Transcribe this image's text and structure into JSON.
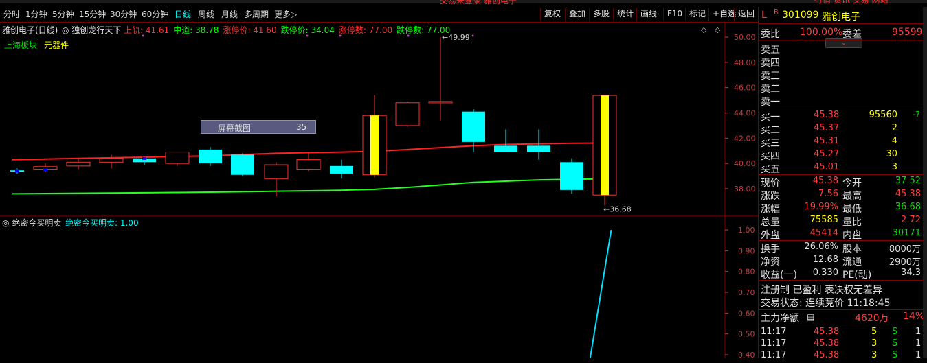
{
  "top_warning": "交易未登录  雅创电子",
  "toolbar": {
    "timeframes": [
      "分时",
      "1分钟",
      "5分钟",
      "15分钟",
      "30分钟",
      "60分钟",
      "日线",
      "周线",
      "月线",
      "多周期",
      "更多▷"
    ],
    "active_timeframe": "日线",
    "buttons": [
      "复权",
      "叠加",
      "多股",
      "统计",
      "画线",
      "F10",
      "标记",
      "+自选",
      "返回"
    ]
  },
  "right_top_buttons": "行情  资讯  交易  网站",
  "chart": {
    "stock_label": "雅创电子(日线)",
    "indicator_name": "独创龙行天下",
    "params": [
      {
        "label": "上轨: 41.61",
        "color": "#ff3030"
      },
      {
        "label": "中道: 38.78",
        "color": "#00ff00"
      },
      {
        "label": "涨停价: 41.60",
        "color": "#ff3030"
      },
      {
        "label": "跌停价: 34.04",
        "color": "#00ff00"
      },
      {
        "label": "涨停数: 77.00",
        "color": "#ff3030"
      },
      {
        "label": "跌停数: 77.00",
        "color": "#00ff00"
      }
    ],
    "sector": "上海板块",
    "industry": "元器件",
    "high_label": "49.99",
    "low_label": "36.68",
    "screenshot_tooltip": {
      "text": "屏幕截图",
      "value": "35"
    },
    "y_ticks": [
      "50.00",
      "48.00",
      "46.00",
      "44.00",
      "42.00",
      "40.00",
      "38.00"
    ]
  },
  "chart_data": {
    "type": "candlestick",
    "ylim": [
      36.0,
      51.0
    ],
    "candles": [
      {
        "o": 39.4,
        "c": 39.4,
        "h": 39.6,
        "l": 39.2,
        "kind": "doji"
      },
      {
        "o": 39.5,
        "c": 39.75,
        "h": 40.0,
        "l": 39.3,
        "kind": "up"
      },
      {
        "o": 39.8,
        "c": 40.1,
        "h": 40.4,
        "l": 39.5,
        "kind": "up"
      },
      {
        "o": 40.1,
        "c": 40.4,
        "h": 40.7,
        "l": 39.6,
        "kind": "up"
      },
      {
        "o": 40.4,
        "c": 40.1,
        "h": 40.5,
        "l": 39.9,
        "kind": "down"
      },
      {
        "o": 40.0,
        "c": 40.9,
        "h": 40.9,
        "l": 39.8,
        "kind": "up"
      },
      {
        "o": 41.1,
        "c": 40.0,
        "h": 41.3,
        "l": 39.8,
        "kind": "down"
      },
      {
        "o": 40.7,
        "c": 39.1,
        "h": 40.8,
        "l": 39.0,
        "kind": "down"
      },
      {
        "o": 38.8,
        "c": 39.9,
        "h": 40.1,
        "l": 37.4,
        "kind": "up"
      },
      {
        "o": 39.5,
        "c": 40.3,
        "h": 40.9,
        "l": 39.4,
        "kind": "up"
      },
      {
        "o": 39.8,
        "c": 39.2,
        "h": 40.3,
        "l": 38.8,
        "kind": "down"
      },
      {
        "o": 39.1,
        "c": 43.8,
        "h": 45.4,
        "l": 38.9,
        "kind": "limit"
      },
      {
        "o": 43.0,
        "c": 44.8,
        "h": 44.9,
        "l": 42.9,
        "kind": "up"
      },
      {
        "o": 44.8,
        "c": 44.9,
        "h": 49.99,
        "l": 43.4,
        "kind": "up"
      },
      {
        "o": 44.1,
        "c": 41.7,
        "h": 44.3,
        "l": 40.9,
        "kind": "down"
      },
      {
        "o": 41.4,
        "c": 40.9,
        "h": 42.7,
        "l": 40.9,
        "kind": "down"
      },
      {
        "o": 41.4,
        "c": 40.9,
        "h": 42.7,
        "l": 40.3,
        "kind": "down"
      },
      {
        "o": 40.1,
        "c": 37.9,
        "h": 40.4,
        "l": 37.6,
        "kind": "down"
      },
      {
        "o": 37.5,
        "c": 45.38,
        "h": 45.38,
        "l": 36.68,
        "kind": "limit"
      }
    ],
    "upper_line": [
      40.3,
      40.35,
      40.4,
      40.45,
      40.5,
      40.55,
      40.6,
      40.7,
      40.8,
      40.85,
      40.9,
      40.95,
      41.1,
      41.25,
      41.4,
      41.5,
      41.55,
      41.6,
      41.61
    ],
    "middle_line": [
      37.6,
      37.62,
      37.64,
      37.66,
      37.68,
      37.7,
      37.73,
      37.76,
      37.8,
      37.84,
      37.88,
      37.95,
      38.1,
      38.3,
      38.5,
      38.6,
      38.7,
      38.75,
      38.78
    ]
  },
  "sub_chart": {
    "name": "绝密今买明卖",
    "value_label": "绝密今买明卖: 1.00",
    "y_ticks": [
      "1.00",
      "0.90",
      "0.80",
      "0.70",
      "0.60",
      "0.50",
      "0.40"
    ],
    "ylim": [
      0.38,
      1.03
    ],
    "line_points": [
      {
        "i": 17.55,
        "v": 0.38
      },
      {
        "i": 18.2,
        "v": 1.0
      }
    ]
  },
  "panel": {
    "flags": [
      "L",
      "R"
    ],
    "code": "301099",
    "name": "雅创电子",
    "weibi_label": "委比",
    "weibi_value": "100.00%",
    "weicha_label": "委差",
    "weicha_value": "95599",
    "sells": [
      "卖五",
      "卖四",
      "卖三",
      "卖二",
      "卖一"
    ],
    "buys": [
      {
        "label": "买一",
        "price": "45.38",
        "vol": "95560",
        "chg": "-7"
      },
      {
        "label": "买二",
        "price": "45.37",
        "vol": "2",
        "chg": ""
      },
      {
        "label": "买三",
        "price": "45.31",
        "vol": "4",
        "chg": ""
      },
      {
        "label": "买四",
        "price": "45.27",
        "vol": "30",
        "chg": ""
      },
      {
        "label": "买五",
        "price": "45.01",
        "vol": "3",
        "chg": ""
      }
    ],
    "stats": [
      {
        "l1": "现价",
        "v1": "45.38",
        "c1": "r",
        "l2": "今开",
        "v2": "37.52",
        "c2": "g"
      },
      {
        "l1": "涨跌",
        "v1": "7.56",
        "c1": "r",
        "l2": "最高",
        "v2": "45.38",
        "c2": "r"
      },
      {
        "l1": "涨幅",
        "v1": "19.99%",
        "c1": "r",
        "l2": "最低",
        "v2": "36.68",
        "c2": "g"
      },
      {
        "l1": "总量",
        "v1": "75585",
        "c1": "y",
        "l2": "量比",
        "v2": "2.72",
        "c2": "r"
      },
      {
        "l1": "外盘",
        "v1": "45414",
        "c1": "r",
        "l2": "内盘",
        "v2": "30171",
        "c2": "g"
      }
    ],
    "stats2": [
      {
        "l1": "换手",
        "v1": "26.06%",
        "l2": "股本",
        "v2": "8000万"
      },
      {
        "l1": "净资",
        "v1": "12.68",
        "l2": "流通",
        "v2": "2900万"
      },
      {
        "l1": "收益(一)",
        "v1": "0.330",
        "l2": "PE(动)",
        "v2": "34.3"
      }
    ],
    "reg_line": "注册制 已盈利 表决权无差异",
    "trade_state": "交易状态: 连续竞价 11:18:45",
    "main_net_label": "主力净额",
    "main_net_value": "4620万",
    "main_net_pct": "14%",
    "ticks": [
      {
        "t": "11:17",
        "p": "45.38",
        "v": "5",
        "s": "S",
        "n": "1"
      },
      {
        "t": "11:17",
        "p": "45.38",
        "v": "3",
        "s": "S",
        "n": "1"
      },
      {
        "t": "11:17",
        "p": "45.38",
        "v": "3",
        "s": "S",
        "n": "1"
      }
    ]
  }
}
